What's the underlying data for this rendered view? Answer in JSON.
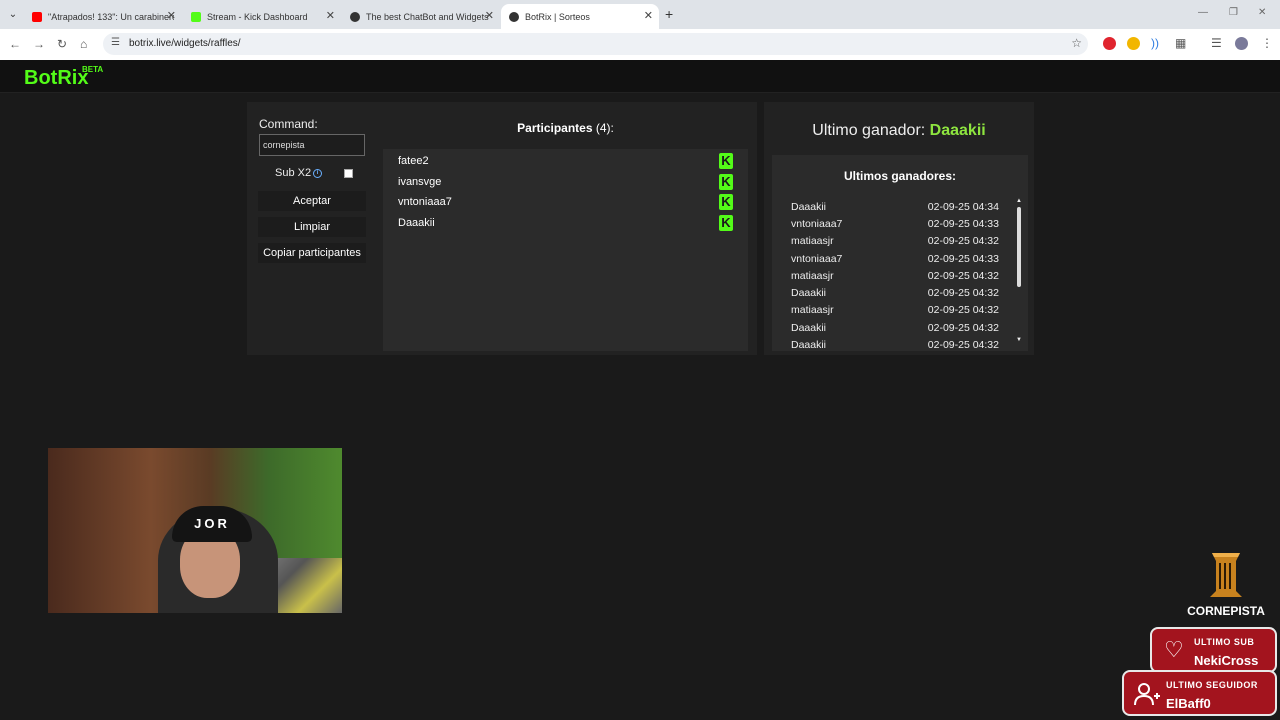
{
  "browser": {
    "tabs": [
      {
        "title": "\"Atrapados! 133\": Un carabinero",
        "favicon_color": "#ff0000"
      },
      {
        "title": "Stream - Kick Dashboard",
        "favicon_color": "#53fc18"
      },
      {
        "title": "The best ChatBot and Widgets",
        "favicon_color": "#333333"
      },
      {
        "title": "BotRix | Sorteos",
        "favicon_color": "#333333"
      }
    ],
    "url": "botrix.live/widgets/raffles/"
  },
  "site": {
    "logo": "BotRix",
    "badge": "BETA",
    "accent_color": "#53fc18"
  },
  "controls": {
    "command_label": "Command:",
    "command_value": "cornepista",
    "sub_label": "Sub X2",
    "accept_label": "Aceptar",
    "clear_label": "Limpiar",
    "copy_label": "Copiar participantes"
  },
  "participants": {
    "title": "Participantes",
    "count": "(4):",
    "items": [
      "fatee2",
      "ivansvge",
      "vntoniaaa7",
      "Daaakii"
    ]
  },
  "winner": {
    "label": "Ultimo ganador:",
    "name": "Daaakii"
  },
  "winners": {
    "title": "Ultimos ganadores:",
    "items": [
      {
        "name": "Daaakii",
        "time": "02-09-25 04:34"
      },
      {
        "name": "vntoniaaa7",
        "time": "02-09-25 04:33"
      },
      {
        "name": "matiaasjr",
        "time": "02-09-25 04:32"
      },
      {
        "name": "vntoniaaa7",
        "time": "02-09-25 04:33"
      },
      {
        "name": "matiaasjr",
        "time": "02-09-25 04:32"
      },
      {
        "name": "Daaakii",
        "time": "02-09-25 04:32"
      },
      {
        "name": "matiaasjr",
        "time": "02-09-25 04:32"
      },
      {
        "name": "Daaakii",
        "time": "02-09-25 04:32"
      },
      {
        "name": "Daaakii",
        "time": "02-09-25 04:32"
      }
    ]
  },
  "overlay": {
    "channel_name": "CORNEPISTA",
    "webcam_hat_text": "JOR",
    "last_sub_label": "ULTIMO SUB",
    "last_sub_value": "NekiCross",
    "last_follower_label": "ULTIMO SEGUIDOR",
    "last_follower_value": "ElBaff0",
    "alert_color": "#a3141e"
  }
}
